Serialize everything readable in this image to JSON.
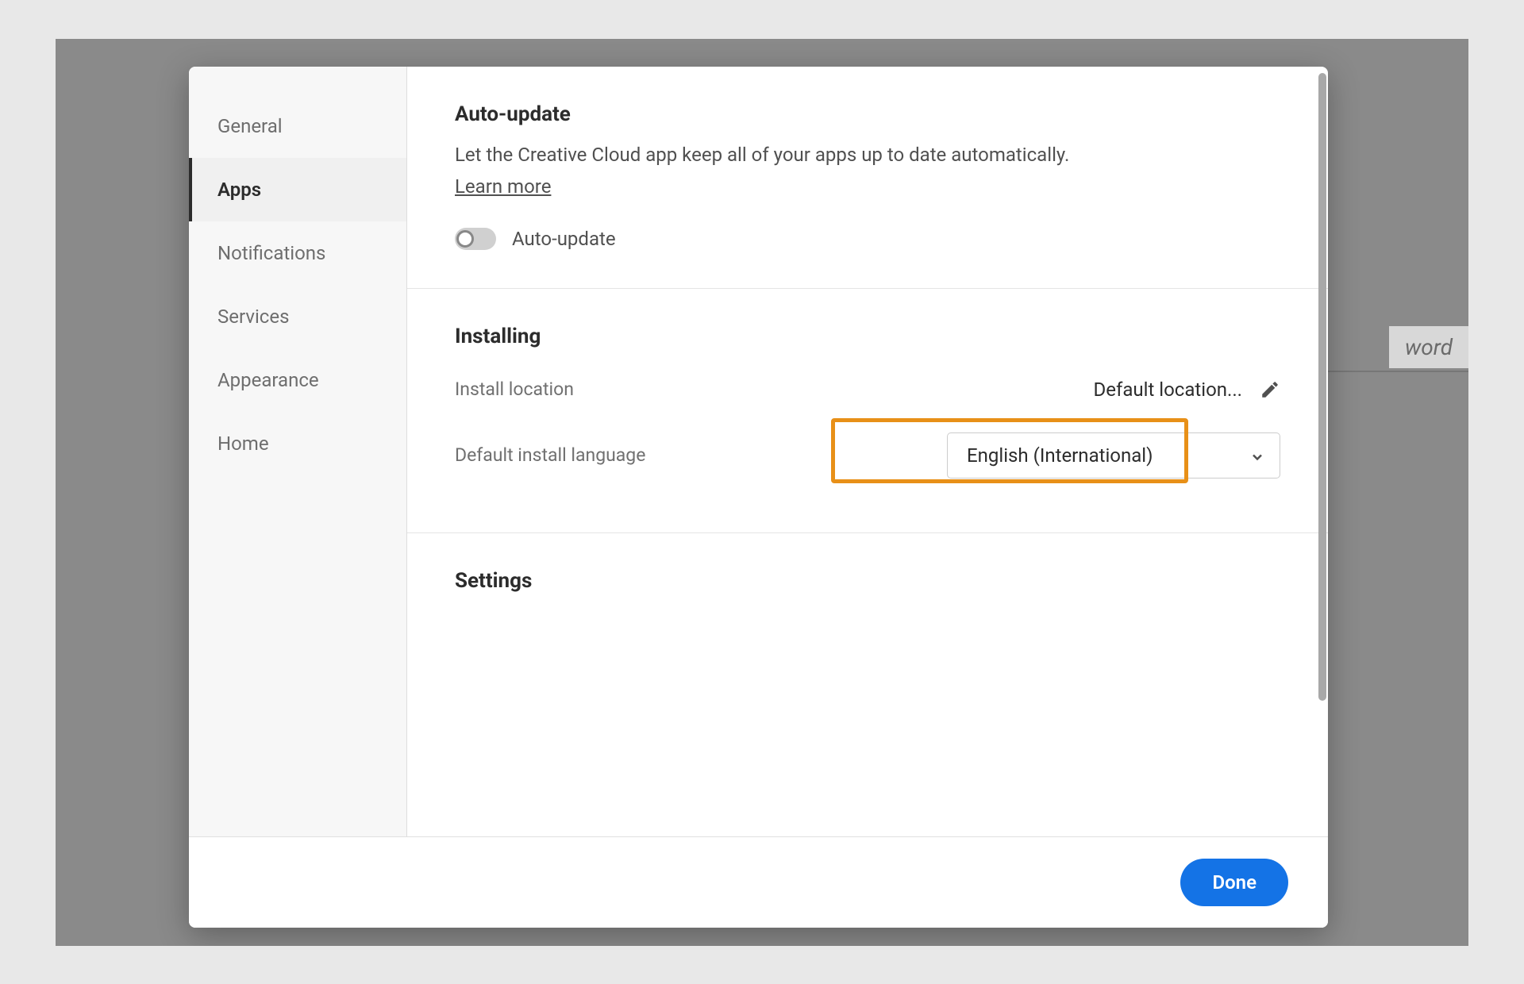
{
  "background": {
    "partial_text": "word"
  },
  "sidebar": {
    "items": [
      {
        "label": "General",
        "active": false
      },
      {
        "label": "Apps",
        "active": true
      },
      {
        "label": "Notifications",
        "active": false
      },
      {
        "label": "Services",
        "active": false
      },
      {
        "label": "Appearance",
        "active": false
      },
      {
        "label": "Home",
        "active": false
      }
    ]
  },
  "sections": {
    "auto_update": {
      "title": "Auto-update",
      "description": "Let the Creative Cloud app keep all of your apps up to date automatically.",
      "learn_more": "Learn more",
      "toggle_label": "Auto-update",
      "toggle_on": false
    },
    "installing": {
      "title": "Installing",
      "location_label": "Install location",
      "location_value": "Default location...",
      "language_label": "Default install language",
      "language_value": "English (International)"
    },
    "settings": {
      "title": "Settings"
    }
  },
  "footer": {
    "done": "Done"
  },
  "highlight": {
    "color": "#e89018"
  }
}
